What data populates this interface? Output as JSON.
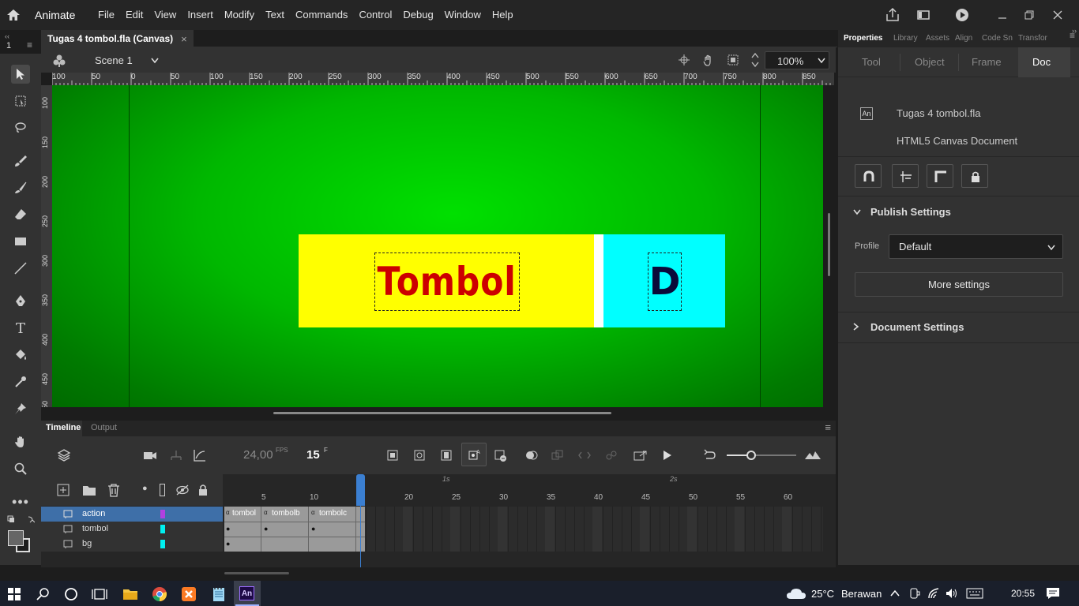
{
  "app": {
    "name": "Animate"
  },
  "menus": [
    "File",
    "Edit",
    "View",
    "Insert",
    "Modify",
    "Text",
    "Commands",
    "Control",
    "Debug",
    "Window",
    "Help"
  ],
  "doc_tab": {
    "title": "Tugas 4 tombol.fla (Canvas)",
    "close": "×"
  },
  "left_number": "1",
  "scene": {
    "label": "Scene 1",
    "zoom": "100%"
  },
  "ruler": {
    "h_labels": [
      "100",
      "50",
      "0",
      "50",
      "100",
      "150",
      "200",
      "250",
      "300",
      "350",
      "400",
      "450",
      "500",
      "550",
      "600",
      "650",
      "700",
      "750",
      "800",
      "850"
    ],
    "v_labels": [
      "100",
      "150",
      "200",
      "250",
      "300",
      "350",
      "400",
      "450",
      "50"
    ]
  },
  "stage": {
    "button_text": "Tombol",
    "side_text": "D",
    "colors": {
      "yellow": "#ffff00",
      "cyan": "#00ffff",
      "text_red": "#cc0000",
      "text_dark": "#0a0a3a"
    }
  },
  "timeline": {
    "tabs": [
      "Timeline",
      "Output"
    ],
    "fps": "24,00",
    "fps_unit": "FPS",
    "frame": "15",
    "frame_unit": "F",
    "seconds": [
      "1s",
      "2s"
    ],
    "frame_numbers": [
      "5",
      "10",
      "20",
      "25",
      "30",
      "35",
      "40",
      "45",
      "50",
      "55",
      "60"
    ],
    "layers": [
      {
        "name": "action",
        "color": "#b040e0",
        "selected": true
      },
      {
        "name": "tombol",
        "color": "#00f0f0",
        "selected": false
      },
      {
        "name": "bg",
        "color": "#00f0f0",
        "selected": false
      }
    ],
    "frame_labels": [
      "tombol",
      "tombolb",
      "tombolc"
    ]
  },
  "properties": {
    "tabs": [
      "Properties",
      "Library",
      "Assets",
      "Align",
      "Code Sn",
      "Transfor"
    ],
    "subtabs": [
      "Tool",
      "Object",
      "Frame",
      "Doc"
    ],
    "doc_icon": "An",
    "file_name": "Tugas 4 tombol.fla",
    "doc_type": "HTML5 Canvas Document",
    "publish_settings": "Publish Settings",
    "profile_label": "Profile",
    "profile_value": "Default",
    "more_settings": "More settings",
    "document_settings": "Document Settings"
  },
  "taskbar": {
    "weather": "25°C",
    "weather_desc": "Berawan",
    "time": "20:55",
    "active_app": "An"
  }
}
